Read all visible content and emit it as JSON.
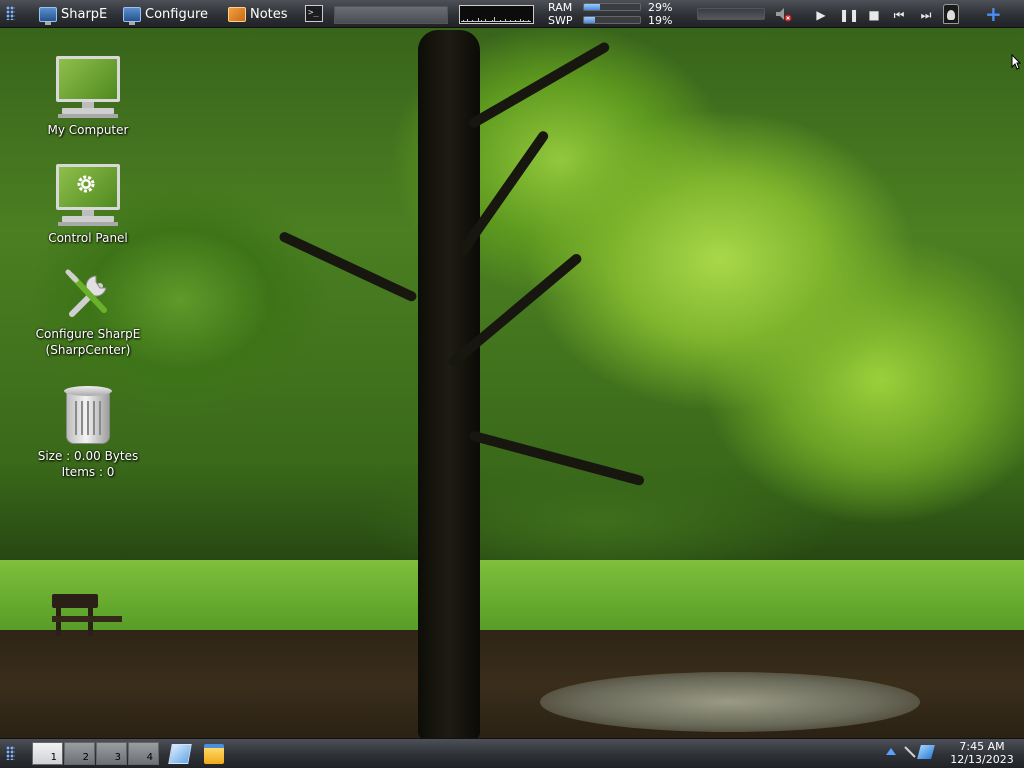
{
  "top_panel": {
    "launchers": [
      {
        "label": "SharpE",
        "icon": "computer-icon"
      },
      {
        "label": "Configure",
        "icon": "computer-icon"
      },
      {
        "label": "Notes",
        "icon": "notes-icon"
      }
    ],
    "terminal_icon": "terminal-icon",
    "memory": {
      "ram_label": "RAM",
      "ram_percent": "29%",
      "ram_fraction": 0.29,
      "swap_label": "SWP",
      "swap_percent": "19%",
      "swap_fraction": 0.19
    },
    "media_controls": [
      "play",
      "pause",
      "stop",
      "previous",
      "next"
    ],
    "add_icon": "plus-icon"
  },
  "desktop": {
    "icons": [
      {
        "label": "My Computer",
        "icon": "computer-icon"
      },
      {
        "label": "Control Panel",
        "icon": "control-panel-icon"
      },
      {
        "label": "Configure SharpE\n(SharpCenter)",
        "icon": "tools-icon"
      },
      {
        "label": "Size : 0.00 Bytes\nItems : 0",
        "icon": "trash-icon"
      }
    ]
  },
  "bottom_panel": {
    "workspaces": [
      "1",
      "2",
      "3",
      "4"
    ],
    "active_workspace": "1",
    "clock_time": "7:45 AM",
    "clock_date": "12/13/2023"
  }
}
